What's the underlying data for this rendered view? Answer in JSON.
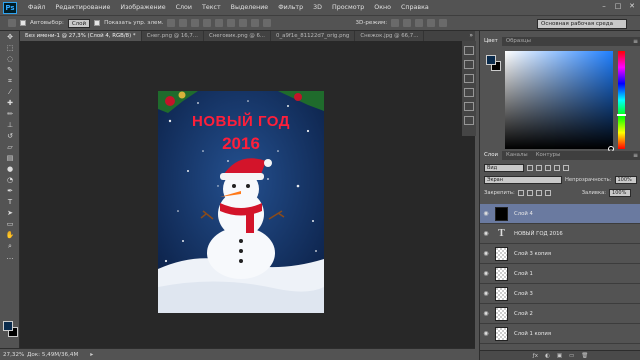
{
  "app": {
    "logo": "Ps"
  },
  "menu": [
    "Файл",
    "Редактирование",
    "Изображение",
    "Слои",
    "Текст",
    "Выделение",
    "Фильтр",
    "3D",
    "Просмотр",
    "Окно",
    "Справка"
  ],
  "window_controls": [
    "–",
    "□",
    "✕"
  ],
  "options": {
    "auto_select_label": "Автовыбор:",
    "auto_select_value": "Слой",
    "show_transform_label": "Показать упр. элем.",
    "mode_3d_label": "3D-режим:",
    "workspace": "Основная рабочая среда"
  },
  "tabs": [
    "Без имени-1 @ 27,3% (Слой 4, RGB/8) *",
    "Снег.png @ 16,7...",
    "Снеговик.png @ 6...",
    "0_a9f1e_81122d7_orig.png",
    "Снежок.jpg @ 66,7..."
  ],
  "tabs_more": "»",
  "artwork": {
    "title": "НОВЫЙ ГОД",
    "year": "2016",
    "colors": {
      "sky": "#12305e",
      "title": "#ff1f3a",
      "snow": "#f2f5fa",
      "scarf": "#d3142a",
      "hat": "#d3142a"
    }
  },
  "status": {
    "zoom": "27,32%",
    "doc": "Док: 5,49M/36,4M",
    "arrow": "▸"
  },
  "color_panel": {
    "tabs": [
      "Цвет",
      "Образцы"
    ],
    "fg": "#0a2b4c",
    "bg": "#000000",
    "menu_icon": "≡"
  },
  "layers_panel": {
    "tabs": [
      "Слои",
      "Каналы",
      "Контуры"
    ],
    "filter_label": "Вид",
    "blend_mode": "Экран",
    "opacity_label": "Непрозрачность:",
    "opacity_value": "100%",
    "lock_label": "Закрепить:",
    "fill_label": "Заливка:",
    "fill_value": "100%",
    "layers": [
      {
        "name": "Слой 4",
        "thumb": "dark",
        "selected": true
      },
      {
        "name": "НОВЫЙ ГОД 2016",
        "thumb": "text",
        "selected": false
      },
      {
        "name": "Слой 3 копия",
        "thumb": "checker",
        "selected": false
      },
      {
        "name": "Слой 1",
        "thumb": "checker",
        "selected": false
      },
      {
        "name": "Слой 3",
        "thumb": "checker",
        "selected": false
      },
      {
        "name": "Слой 2",
        "thumb": "checker",
        "selected": false
      },
      {
        "name": "Слой 1 копия",
        "thumb": "checker",
        "selected": false
      }
    ],
    "text_thumb_glyph": "T",
    "eye_glyph": "◉",
    "footer": [
      "ƒx",
      "◐",
      "▣",
      "▭",
      "🗑"
    ]
  }
}
